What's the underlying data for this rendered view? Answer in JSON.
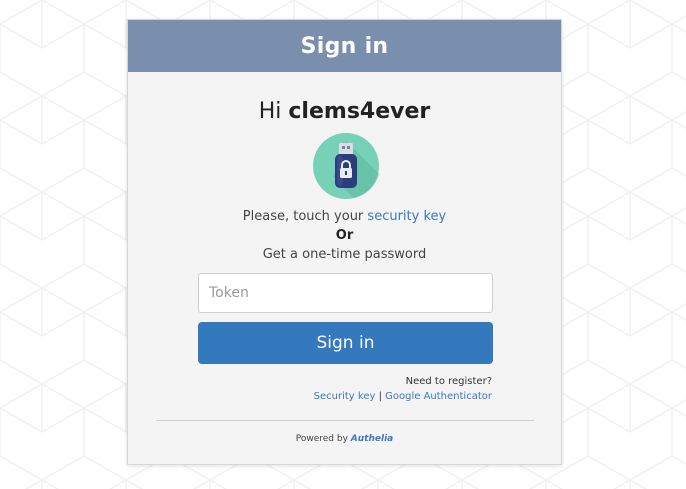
{
  "header": {
    "title": "Sign in"
  },
  "greeting": {
    "prefix": "Hi",
    "username": "clems4ever"
  },
  "icons": {
    "security_key": "usb-security-key-icon"
  },
  "prompt": {
    "text": "Please, touch your",
    "link": "security key",
    "or": "Or",
    "otp": "Get a one-time password"
  },
  "form": {
    "token_placeholder": "Token",
    "token_value": "",
    "submit_label": "Sign in"
  },
  "register": {
    "question": "Need to register?",
    "security_key_link": "Security key",
    "separator": "|",
    "authenticator_link": "Google Authenticator"
  },
  "footer": {
    "powered_by": "Powered by",
    "brand": "Authelia"
  },
  "colors": {
    "header_bg": "#7a8eae",
    "accent": "#3478bd",
    "link": "#3b78c0",
    "icon_circle": "#76d1b6"
  }
}
